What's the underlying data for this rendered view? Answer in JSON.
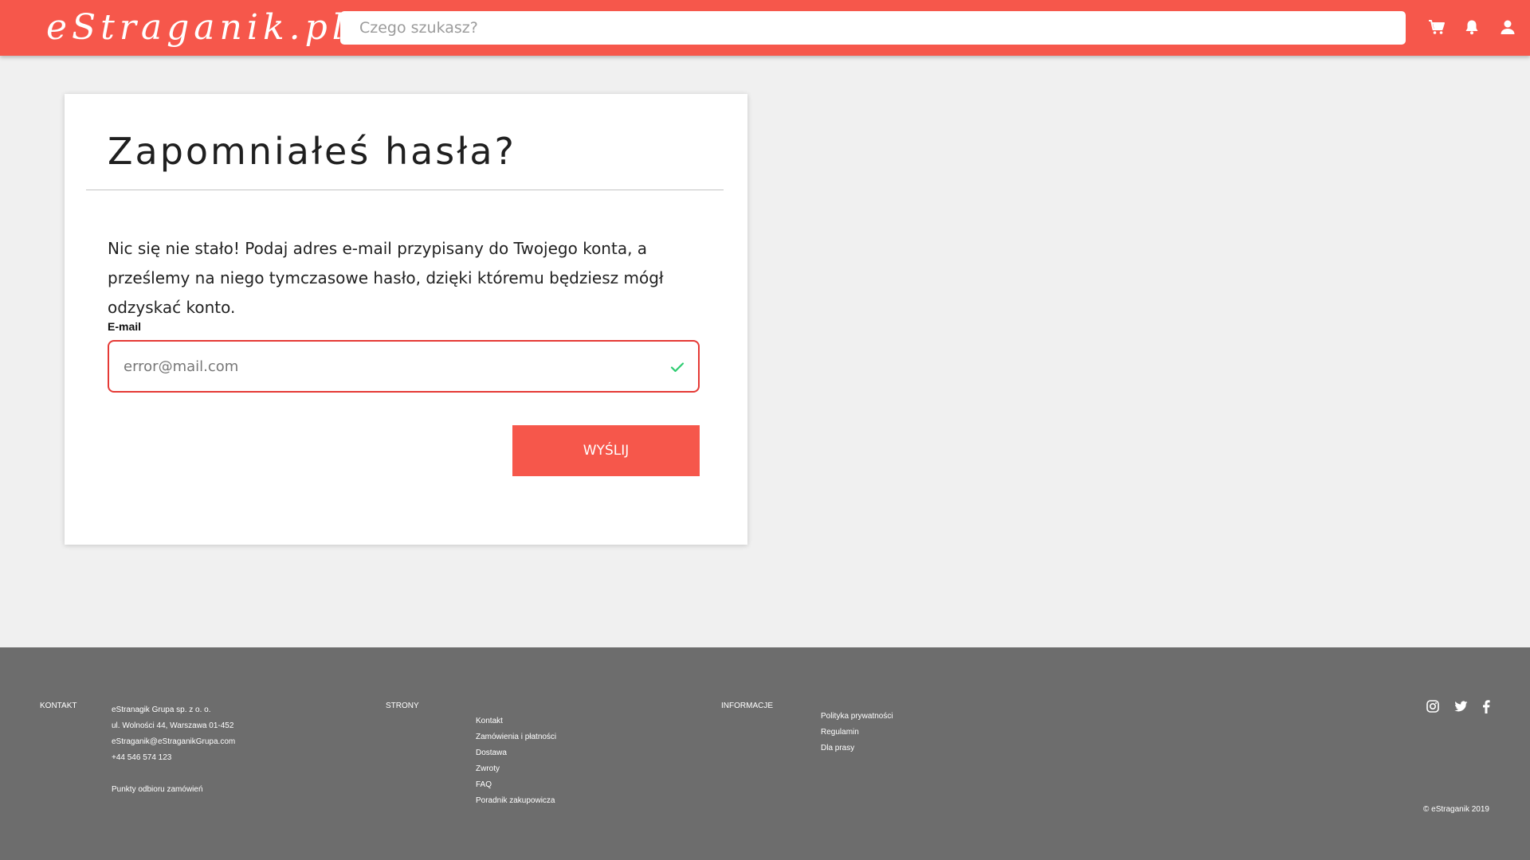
{
  "header": {
    "logo": "eStraganik.pl",
    "search_placeholder": "Czego szukasz?",
    "icons": [
      "cart-icon",
      "bell-icon",
      "user-icon"
    ]
  },
  "card": {
    "title": "Zapomniałeś hasła?",
    "description": "Nic się nie stało! Podaj adres e-mail przypisany do Twojego konta, a prześlemy na niego tymczasowe hasło, dzięki któremu będziesz mógł odzyskać konto.",
    "email_label": "E-mail",
    "email_value": "error@mail.com",
    "submit_label": "WYŚLIJ"
  },
  "footer": {
    "contact": {
      "heading": "KONTAKT",
      "lines": [
        "eStranagik Grupa sp. z o. o.",
        "ul. Wolności 44, Warszawa 01-452",
        "eStraganik@eStraganikGrupa.com",
        "+44 546 574 123"
      ],
      "pickup_link": "Punkty odbioru zamówień"
    },
    "pages": {
      "heading": "STRONY",
      "links": [
        "Kontakt",
        "Zamówienia i płatności",
        "Dostawa",
        "Zwroty",
        "FAQ",
        "Poradnik zakupowicza"
      ]
    },
    "info": {
      "heading": "INFORMACJE",
      "links": [
        "Polityka prywatności",
        "Regulamin",
        "Dla prasy"
      ]
    },
    "social_icons": [
      "instagram-icon",
      "twitter-icon",
      "facebook-icon"
    ],
    "copyright": "© eStraganik 2019"
  },
  "colors": {
    "accent": "#f6574b",
    "error_border": "#e53935",
    "success_check": "#2ecc71",
    "footer_bg": "#6d6d6d",
    "page_bg": "#f0f0f0"
  }
}
